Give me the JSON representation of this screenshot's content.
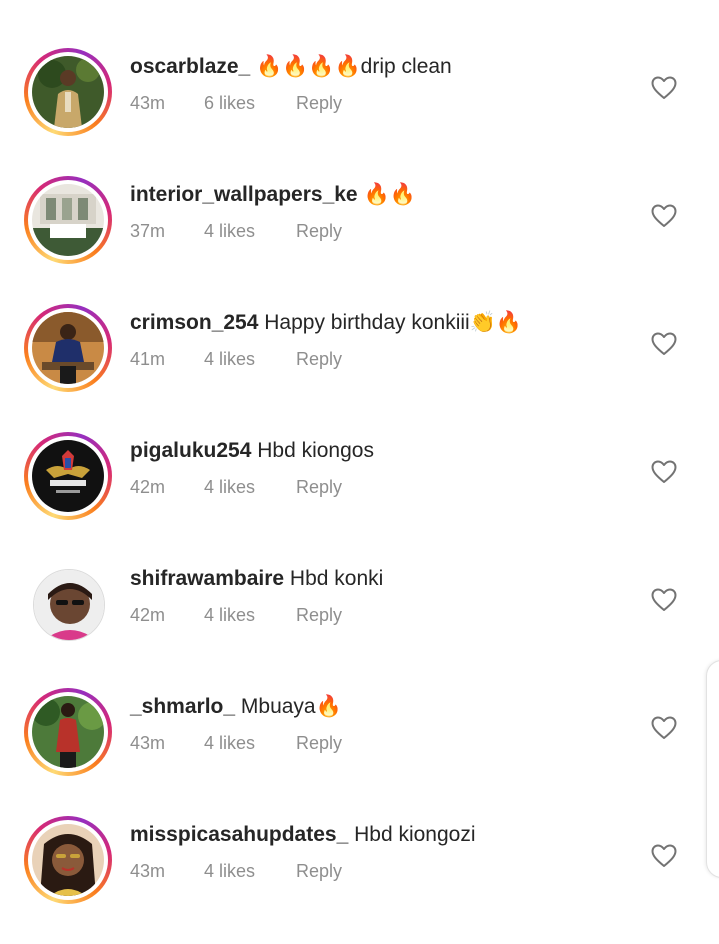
{
  "comments": [
    {
      "username": "oscarblaze_",
      "text": " 🔥🔥🔥🔥drip clean",
      "time": "43m",
      "likes": "6 likes",
      "reply": "Reply",
      "has_story_ring": true,
      "avatar_icon": "avatar-photo"
    },
    {
      "username": "interior_wallpapers_ke",
      "text": " 🔥🔥",
      "time": "37m",
      "likes": "4 likes",
      "reply": "Reply",
      "has_story_ring": true,
      "avatar_icon": "avatar-photo"
    },
    {
      "username": "crimson_254",
      "text": " Happy birthday konkiii👏🔥",
      "time": "41m",
      "likes": "4 likes",
      "reply": "Reply",
      "has_story_ring": true,
      "avatar_icon": "avatar-photo"
    },
    {
      "username": "pigaluku254",
      "text": " Hbd kiongos",
      "time": "42m",
      "likes": "4 likes",
      "reply": "Reply",
      "has_story_ring": true,
      "avatar_icon": "avatar-logo"
    },
    {
      "username": "shifrawambaire",
      "text": " Hbd konki",
      "time": "42m",
      "likes": "4 likes",
      "reply": "Reply",
      "has_story_ring": false,
      "avatar_icon": "avatar-photo"
    },
    {
      "username": "_shmarlo_",
      "text": " Mbuaya🔥",
      "time": "43m",
      "likes": "4 likes",
      "reply": "Reply",
      "has_story_ring": true,
      "avatar_icon": "avatar-photo"
    },
    {
      "username": "misspicasahupdates_",
      "text": " Hbd kiongozi",
      "time": "43m",
      "likes": "4 likes",
      "reply": "Reply",
      "has_story_ring": true,
      "avatar_icon": "avatar-photo"
    }
  ],
  "icons": {
    "like": "heart-outline-icon"
  },
  "colors": {
    "username": "#262626",
    "meta": "#8e8e8e",
    "story_ring_start": "#feda75",
    "story_ring_mid": "#d62976",
    "story_ring_end": "#962fbf"
  }
}
